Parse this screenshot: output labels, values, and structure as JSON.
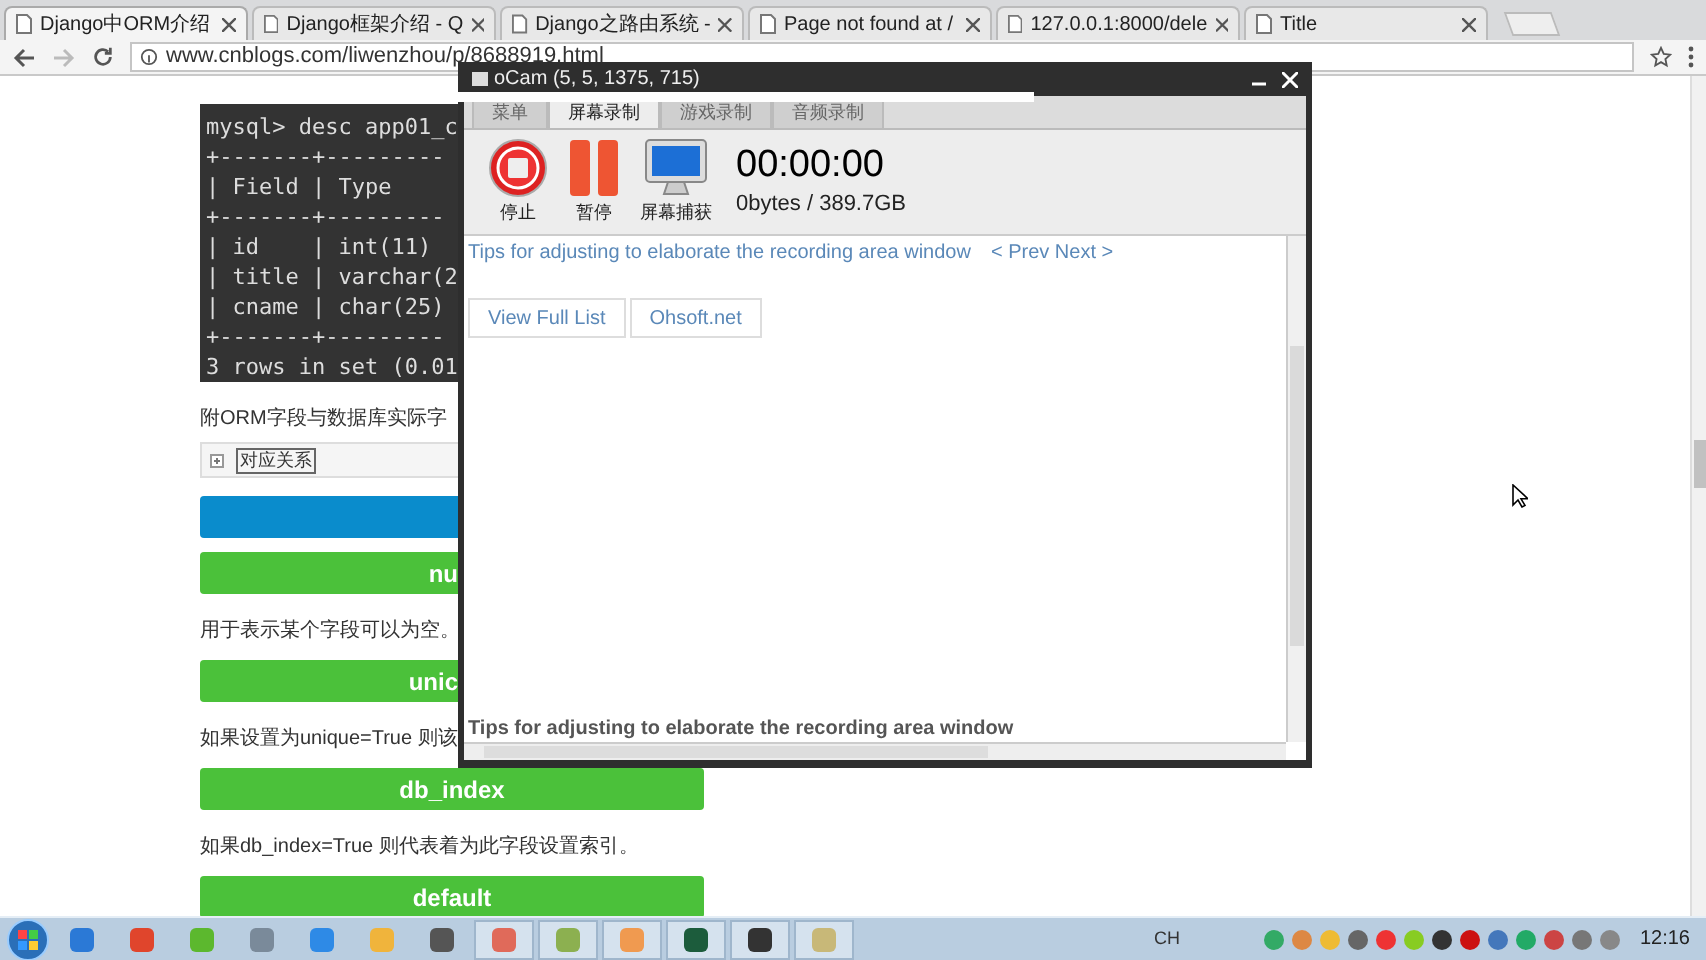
{
  "browser": {
    "tabs": [
      {
        "label": "Django中ORM介绍",
        "selected": true
      },
      {
        "label": "Django框架介绍 - Q",
        "selected": false
      },
      {
        "label": "Django之路由系统 - ",
        "selected": false
      },
      {
        "label": "Page not found at /",
        "selected": false
      },
      {
        "label": "127.0.0.1:8000/dele",
        "selected": false
      },
      {
        "label": "Title",
        "selected": false
      }
    ],
    "address": "www.cnblogs.com/liwenzhou/p/8688919.html"
  },
  "page": {
    "terminal_lines": [
      "mysql> desc app01_c",
      "+-------+---------",
      "| Field | Type",
      "+-------+---------",
      "| id    | int(11)",
      "| title | varchar(2",
      "| cname | char(25)",
      "+-------+---------",
      "3 rows in set (0.01"
    ],
    "blocks": [
      {
        "kind": "text",
        "text": "附ORM字段与数据库实际字"
      },
      {
        "kind": "collapse",
        "text": "对应关系"
      },
      {
        "kind": "blue_bar"
      },
      {
        "kind": "green_bar",
        "text": "nu",
        "cut": true
      },
      {
        "kind": "text",
        "text": "用于表示某个字段可以为空。"
      },
      {
        "kind": "green_bar",
        "text": "unic",
        "cut": true
      },
      {
        "kind": "text",
        "text": "如果设置为unique=True 则该"
      },
      {
        "kind": "green_bar",
        "text": "db_index",
        "cut": false
      },
      {
        "kind": "text",
        "text": "如果db_index=True 则代表着为此字段设置索引。"
      },
      {
        "kind": "green_bar",
        "text": "default",
        "cut": false
      }
    ]
  },
  "ocam": {
    "title": "oCam (5, 5, 1375, 715)",
    "tabs": [
      {
        "label": "菜单",
        "selected": false
      },
      {
        "label": "屏幕录制",
        "selected": true
      },
      {
        "label": "游戏录制",
        "selected": false
      },
      {
        "label": "音频录制",
        "selected": false
      }
    ],
    "tools": [
      {
        "kind": "stop",
        "label": "停止"
      },
      {
        "kind": "pause",
        "label": "暂停"
      },
      {
        "kind": "capture",
        "label": "屏幕捕获"
      }
    ],
    "timer": "00:00:00",
    "size": "0bytes / 389.7GB",
    "tip": "Tips for adjusting to elaborate the recording area window",
    "nav": "< Prev Next >",
    "buttons": [
      "View Full List",
      "Ohsoft.net"
    ],
    "footer": "Tips for adjusting to elaborate the recording area window"
  },
  "taskbar": {
    "tray_lang": "CH",
    "clock": "12:16"
  }
}
